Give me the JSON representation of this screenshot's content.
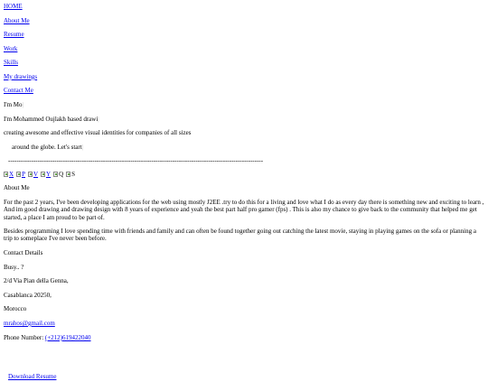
{
  "nav": [
    "HOME",
    "About Me",
    "Resume",
    "Work",
    "Skills",
    "My drawings",
    "Contact Me"
  ],
  "intro": {
    "line1": "I'm Mo",
    "line2": "I'm Mohammed Oujlakh based drawi",
    "line3": "creating awesome and effective visual identities for companies of all sizes",
    "line4": "around the globe. Let's start",
    "cursor": "|"
  },
  "divider": "-------------------------------------------------------------------------------------------------------------------------",
  "social": [
    {
      "icon": "x-icon",
      "letter": "X"
    },
    {
      "icon": "p-icon",
      "letter": "P"
    },
    {
      "icon": "v-icon",
      "letter": "V"
    },
    {
      "icon": "y-icon",
      "letter": "Y"
    },
    {
      "icon": "q-icon",
      "letter": "Q"
    },
    {
      "icon": "s-icon",
      "letter": "S"
    }
  ],
  "about": {
    "heading": "About Me",
    "para1": "For the past 2 years, I've been developing applications for the web using mostly J2EE .try to do this for a living and love what I do as every day there is something new and exciting to learn , And im good drawing and drawing design with 8 years of experience and yeah the best part half pro gamer (fps) . This is also my chance to give back to the community that helped me get started, a place I am proud to be part of.",
    "para2": "Besides programming I love spending time with friends and family and can often be found together going out catching the latest movie, staying in playing games on the sofa or planning a trip to someplace I've never been before."
  },
  "contact": {
    "heading": "Contact Details",
    "status": "Busy.. ?",
    "address1": "2/d Via Pian della Genna,",
    "address2": "Casablanca 20250,",
    "country": "Morocco",
    "email": "mrahos@gmail.com",
    "phone_label": "Phone Number: ",
    "phone": "(+212)619422040"
  },
  "download": "Download  Resume"
}
